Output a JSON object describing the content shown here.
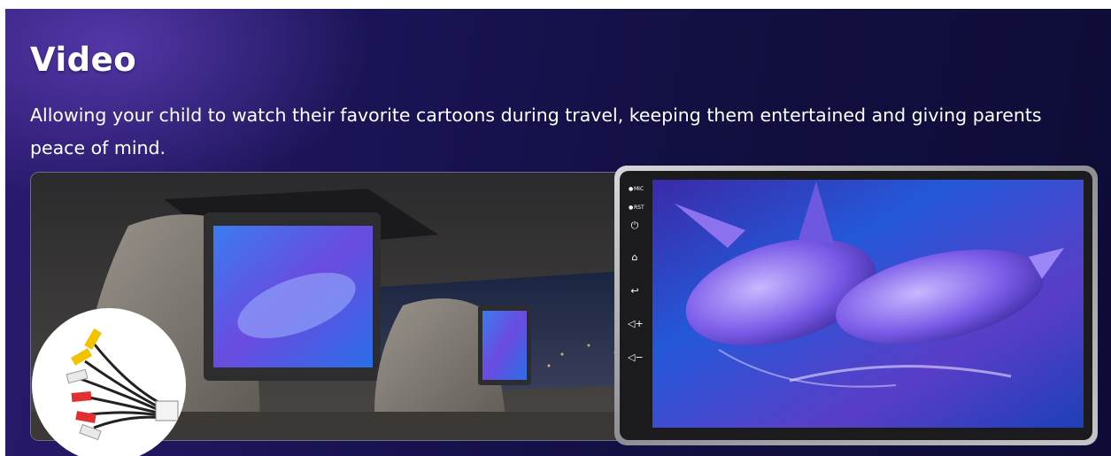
{
  "banner": {
    "title": "Video",
    "subtitle": "Allowing your child to watch their favorite cartoons during travel, keeping them entertained and giving parents peace of mind."
  },
  "head_unit": {
    "labels": {
      "mic": "MIC",
      "rst": "RST"
    },
    "buttons": [
      {
        "name": "power",
        "glyph": "⏻"
      },
      {
        "name": "home",
        "glyph": "⌂"
      },
      {
        "name": "back",
        "glyph": "↩"
      },
      {
        "name": "volume-up",
        "glyph": "◁+"
      },
      {
        "name": "volume-down",
        "glyph": "◁−"
      }
    ]
  },
  "colors": {
    "banner_dark": "#120f42",
    "banner_light": "#2b1a6e",
    "text": "#ffffff",
    "screen_blue": "#1c4fd6",
    "screen_purple": "#7a3fd0"
  },
  "icons": [
    "mic-icon",
    "reset-icon",
    "power-icon",
    "home-icon",
    "back-icon",
    "volume-up-icon",
    "volume-down-icon"
  ]
}
